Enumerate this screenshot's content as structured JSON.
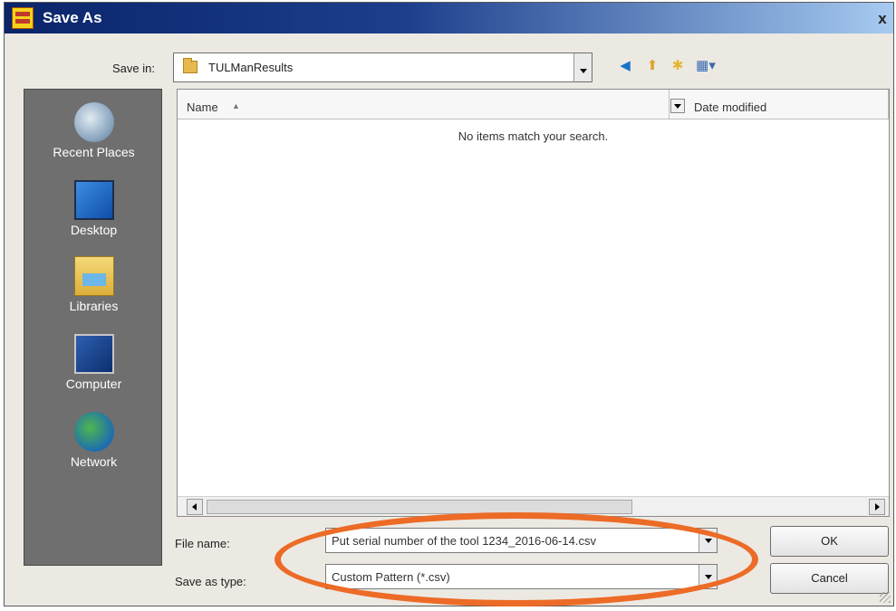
{
  "window": {
    "title": "Save As",
    "close_glyph": "x"
  },
  "toolbar": {
    "save_in_label": "Save in:",
    "save_in_value": "TULManResults",
    "icons": [
      "back-icon",
      "up-folder-icon",
      "new-folder-icon",
      "views-menu-icon"
    ]
  },
  "sidebar": {
    "items": [
      {
        "label": "Recent Places",
        "icon": "recent-places-icon"
      },
      {
        "label": "Desktop",
        "icon": "desktop-icon"
      },
      {
        "label": "Libraries",
        "icon": "libraries-icon"
      },
      {
        "label": "Computer",
        "icon": "computer-icon"
      },
      {
        "label": "Network",
        "icon": "network-icon"
      }
    ]
  },
  "file_list": {
    "columns": [
      "Name",
      "Date modified"
    ],
    "empty_message": "No items match your search."
  },
  "form": {
    "file_name_label": "File name:",
    "file_name_value": "Put serial number of the tool 1234_2016-06-14.csv",
    "save_as_type_label": "Save as type:",
    "save_as_type_value": "Custom Pattern (*.csv)"
  },
  "buttons": {
    "ok": "OK",
    "cancel": "Cancel"
  },
  "annotation": {
    "color": "#ec6b26"
  }
}
